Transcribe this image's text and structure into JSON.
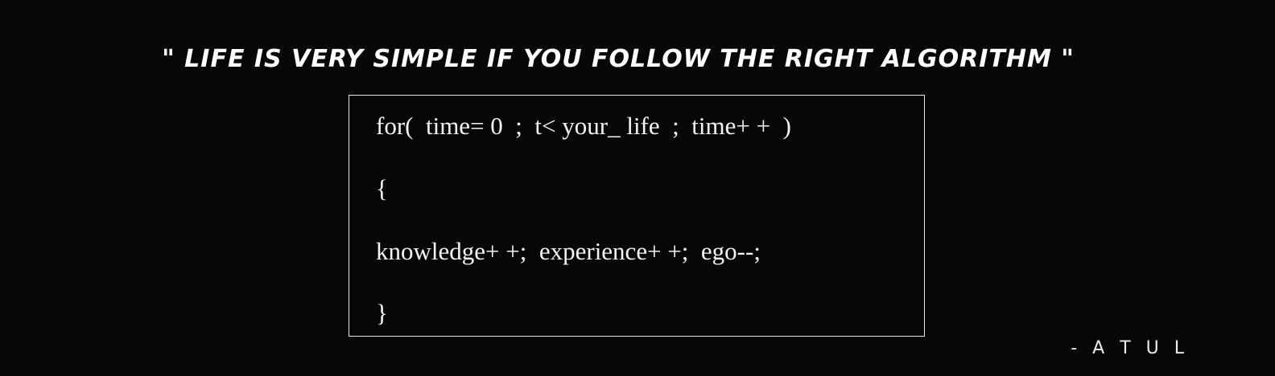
{
  "quote": "\" life is very simple if you follow the right algorithm \"",
  "code": {
    "line1": "for(  time= 0  ;  t< your_ life  ;  time+ +  )",
    "line2": "{",
    "line3": "knowledge+ +;  experience+ +;  ego--;",
    "line4": "}"
  },
  "author": "- A T U L",
  "colors": {
    "background": "#070707",
    "text": "#ffffff",
    "border": "#e6e6e6"
  }
}
